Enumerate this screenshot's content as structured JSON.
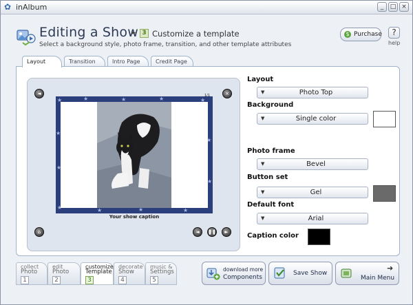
{
  "window": {
    "app_title": "inAlbum",
    "controls": {
      "minimize": "_",
      "maximize": "□",
      "close": "×"
    }
  },
  "header": {
    "title": "Editing a Show",
    "arrow": "►",
    "step_number": "3",
    "step_title": "Customize a template",
    "subtitle": "Select a background style, photo frame, transition, and other template attributes",
    "purchase_label": "Purchase",
    "help_symbol": "?",
    "help_label": "help"
  },
  "tabs": [
    {
      "label": "Layout",
      "active": true
    },
    {
      "label": "Transition",
      "active": false
    },
    {
      "label": "Intro Page",
      "active": false
    },
    {
      "label": "Credit Page",
      "active": false
    }
  ],
  "preview": {
    "caption": "Your show caption",
    "counter": "1/1",
    "controls": {
      "prev": "◄",
      "pause": "❚❚",
      "next": "►"
    }
  },
  "properties": {
    "layout": {
      "label": "Layout",
      "value": "Photo Top"
    },
    "background": {
      "label": "Background",
      "value": "Single color",
      "color": "#ffffff"
    },
    "photo_frame": {
      "label": "Photo frame",
      "value": "Bevel"
    },
    "button_set": {
      "label": "Button set",
      "value": "Gel",
      "color": "#6a6a6a"
    },
    "default_font": {
      "label": "Default font",
      "value": "Arial"
    },
    "caption_color": {
      "label": "Caption color",
      "color": "#000000"
    },
    "dropdown_arrow": "▼"
  },
  "steps": [
    {
      "line1": "collect",
      "line2": "Photo",
      "number": "1",
      "active": false
    },
    {
      "line1": "edit",
      "line2": "Photo",
      "number": "2",
      "active": false
    },
    {
      "line1": "customize",
      "line2": "Template",
      "number": "3",
      "active": true
    },
    {
      "line1": "decorate",
      "line2": "Show",
      "number": "4",
      "active": false
    },
    {
      "line1": "music &",
      "line2": "Settings",
      "number": "5",
      "active": false
    }
  ],
  "actions": {
    "download_line1": "download more",
    "download_line2": "Components",
    "save_show": "Save Show",
    "main_menu": "Main Menu"
  }
}
